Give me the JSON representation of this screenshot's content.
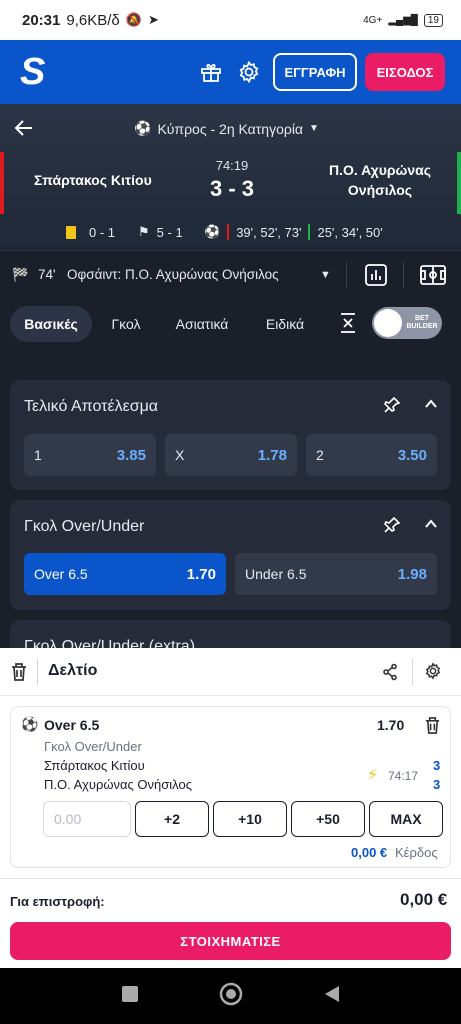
{
  "status": {
    "time": "20:31",
    "net": "9,6KB/δ",
    "battery": "19",
    "net_type": "4G+"
  },
  "header": {
    "logo": "S",
    "register_label": "ΕΓΓΡΑΦΗ",
    "login_label": "ΕΙΣΟΔΟΣ",
    "accent": "#0a55c9",
    "pink": "#ea1c66"
  },
  "match": {
    "league": "Κύπρος - 2η Κατηγορία",
    "home": "Σπάρτακος Κιτίου",
    "away": "Π.Ο. Αχυρώνας Ονήσιλος",
    "minute": "74:19",
    "score": "3 - 3",
    "cards": "0 - 1",
    "corners": "5 - 1",
    "home_goals": "39', 52', 73'",
    "away_goals": "25', 34', 50'"
  },
  "event": {
    "minute": "74'",
    "text": "Οφσάιντ: Π.Ο. Αχυρώνας Ονήσιλος"
  },
  "tabs": [
    {
      "label": "Βασικές"
    },
    {
      "label": "Γκολ"
    },
    {
      "label": "Ασιατικά"
    },
    {
      "label": "Ειδικά"
    }
  ],
  "toggle": {
    "line1": "BET",
    "line2": "BUILDER"
  },
  "markets": [
    {
      "title": "Τελικό Αποτέλεσμα",
      "odds": [
        {
          "label": "1",
          "value": "3.85"
        },
        {
          "label": "X",
          "value": "1.78"
        },
        {
          "label": "2",
          "value": "3.50"
        }
      ]
    },
    {
      "title": "Γκολ Over/Under",
      "odds": [
        {
          "label": "Over 6.5",
          "value": "1.70"
        },
        {
          "label": "Under 6.5",
          "value": "1.98"
        }
      ]
    },
    {
      "title": "Γκολ Over/Under (extra)"
    }
  ],
  "slip": {
    "title": "Δελτίο",
    "selection": "Over 6.5",
    "odds": "1.70",
    "market": "Γκολ Over/Under",
    "home": "Σπάρτακος Κιτίου",
    "away": "Π.Ο. Αχυρώνας Ονήσιλος",
    "minute": "74:17",
    "home_score": "3",
    "away_score": "3",
    "stake_placeholder": "0.00",
    "quick": [
      "+2",
      "+10",
      "+50",
      "MAX"
    ],
    "profit_value": "0,00 €",
    "profit_label": "Κέρδος",
    "return_label": "Για επιστροφή:",
    "return_value": "0,00 €",
    "bet_label": "ΣΤΟΙΧΗΜΑΤΙΣΕ"
  }
}
